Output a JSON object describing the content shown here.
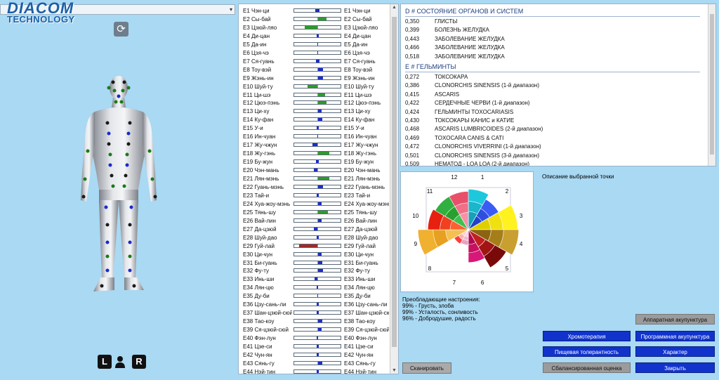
{
  "logo": {
    "line1": "DIACOM",
    "line2": "TECHNOLOGY"
  },
  "select": {
    "value": "",
    "arrow": "▾"
  },
  "icons": {
    "refresh": "⟳"
  },
  "lr": {
    "left": "L",
    "right": "R"
  },
  "meridians": [
    {
      "left": "E1 Чэн-ци",
      "right": "E1 Чэн-ци",
      "dir": "center",
      "size": 6,
      "color": "blue"
    },
    {
      "left": "E2 Сы-бай",
      "right": "E2 Сы-бай",
      "dir": "right",
      "size": 12,
      "color": "green"
    },
    {
      "left": "E3 Цзюй-ляо",
      "right": "E3 Цзюй-ляо",
      "dir": "left",
      "size": 18,
      "color": "green"
    },
    {
      "left": "E4 Ди-цан",
      "right": "E4 Ди-цан",
      "dir": "center",
      "size": 3,
      "color": "blue"
    },
    {
      "left": "E5 Да-ин",
      "right": "E5 Да-ин",
      "dir": "center",
      "size": 1,
      "color": "blue"
    },
    {
      "left": "E6 Цзя-чэ",
      "right": "E6 Цзя-чэ",
      "dir": "center",
      "size": 1,
      "color": "blue"
    },
    {
      "left": "E7 Ся-гуань",
      "right": "E7 Ся-гуань",
      "dir": "center",
      "size": 5,
      "color": "blue"
    },
    {
      "left": "E8 Тоу-вэй",
      "right": "E8 Тоу-вэй",
      "dir": "right",
      "size": 7,
      "color": "blue"
    },
    {
      "left": "E9 Жэнь-ин",
      "right": "E9 Жэнь-ин",
      "dir": "right",
      "size": 7,
      "color": "blue"
    },
    {
      "left": "E10 Шуй-ту",
      "right": "E10 Шуй-ту",
      "dir": "left",
      "size": 14,
      "color": "green"
    },
    {
      "left": "E11 Ци-шэ",
      "right": "E11 Ци-шэ",
      "dir": "right",
      "size": 10,
      "color": "green"
    },
    {
      "left": "E12 Цюэ-пэнь",
      "right": "E12 Цюэ-пэнь",
      "dir": "right",
      "size": 12,
      "color": "green"
    },
    {
      "left": "E13 Ци-ху",
      "right": "E13 Ци-ху",
      "dir": "right",
      "size": 5,
      "color": "blue"
    },
    {
      "left": "E14 Ку-фан",
      "right": "E14 Ку-фан",
      "dir": "right",
      "size": 6,
      "color": "blue"
    },
    {
      "left": "E15 У-и",
      "right": "E15 У-и",
      "dir": "center",
      "size": 3,
      "color": "blue"
    },
    {
      "left": "E16 Ин-чуан",
      "right": "E16 Ин-чуан",
      "dir": "center",
      "size": 1,
      "color": "blue"
    },
    {
      "left": "E17 Жу-чжун",
      "right": "E17 Жу-чжун",
      "dir": "left",
      "size": 7,
      "color": "blue"
    },
    {
      "left": "E18 Жу-гэнь",
      "right": "E18 Жу-гэнь",
      "dir": "right",
      "size": 16,
      "color": "green"
    },
    {
      "left": "E19 Бу-жун",
      "right": "E19 Бу-жун",
      "dir": "center",
      "size": 4,
      "color": "blue"
    },
    {
      "left": "E20 Чэн-мань",
      "right": "E20 Чэн-мань",
      "dir": "left",
      "size": 5,
      "color": "blue"
    },
    {
      "left": "E21 Лян-мэнь",
      "right": "E21 Лян-мэнь",
      "dir": "right",
      "size": 16,
      "color": "green"
    },
    {
      "left": "E22 Гуань-мэнь",
      "right": "E22 Гуань-мэнь",
      "dir": "right",
      "size": 7,
      "color": "blue"
    },
    {
      "left": "E23 Тай-и",
      "right": "E23 Тай-и",
      "dir": "center",
      "size": 3,
      "color": "blue"
    },
    {
      "left": "E24 Хуа-жоу-мэнь",
      "right": "E24 Хуа-жоу-мэнь",
      "dir": "right",
      "size": 5,
      "color": "blue"
    },
    {
      "left": "E25 Тянь-шу",
      "right": "E25 Тянь-шу",
      "dir": "right",
      "size": 14,
      "color": "green"
    },
    {
      "left": "E26 Вай-лин",
      "right": "E26 Вай-лин",
      "dir": "right",
      "size": 5,
      "color": "blue"
    },
    {
      "left": "E27 Да-цзюй",
      "right": "E27 Да-цзюй",
      "dir": "left",
      "size": 5,
      "color": "blue"
    },
    {
      "left": "E28 Шуй-дао",
      "right": "E28 Шуй-дао",
      "dir": "center",
      "size": 3,
      "color": "blue"
    },
    {
      "left": "E29 Гуй-лай",
      "right": "E29 Гуй-лай",
      "dir": "left",
      "size": 26,
      "color": "red"
    },
    {
      "left": "E30 Ци-чун",
      "right": "E30 Ци-чун",
      "dir": "right",
      "size": 5,
      "color": "blue"
    },
    {
      "left": "E31 Би-гуань",
      "right": "E31 Би-гуань",
      "dir": "right",
      "size": 6,
      "color": "blue"
    },
    {
      "left": "E32 Фу-ту",
      "right": "E32 Фу-ту",
      "dir": "right",
      "size": 7,
      "color": "blue"
    },
    {
      "left": "E33 Инь-ши",
      "right": "E33 Инь-ши",
      "dir": "left",
      "size": 4,
      "color": "blue"
    },
    {
      "left": "E34 Лян-цю",
      "right": "E34 Лян-цю",
      "dir": "center",
      "size": 2,
      "color": "blue"
    },
    {
      "left": "E35 Ду-би",
      "right": "E35 Ду-би",
      "dir": "center",
      "size": 1,
      "color": "blue"
    },
    {
      "left": "E36 Цзу-сань-ли",
      "right": "E36 Цзу-сань-ли",
      "dir": "center",
      "size": 3,
      "color": "blue"
    },
    {
      "left": "E37 Шан-цзюй-сюй",
      "right": "E37 Шан-цзюй-сюй",
      "dir": "center",
      "size": 3,
      "color": "blue"
    },
    {
      "left": "E38 Тао-коу",
      "right": "E38 Тао-коу",
      "dir": "right",
      "size": 6,
      "color": "blue"
    },
    {
      "left": "E39 Ся-цзюй-сюй",
      "right": "E39 Ся-цзюй-сюй",
      "dir": "right",
      "size": 5,
      "color": "blue"
    },
    {
      "left": "E40 Фэн-лун",
      "right": "E40 Фэн-лун",
      "dir": "center",
      "size": 2,
      "color": "blue"
    },
    {
      "left": "E41 Цзе-си",
      "right": "E41 Цзе-си",
      "dir": "center",
      "size": 3,
      "color": "blue"
    },
    {
      "left": "E42 Чун-ян",
      "right": "E42 Чун-ян",
      "dir": "center",
      "size": 3,
      "color": "blue"
    },
    {
      "left": "E43 Сянь-гу",
      "right": "E43 Сянь-гу",
      "dir": "right",
      "size": 6,
      "color": "blue"
    },
    {
      "left": "E44 Нэй-тин",
      "right": "E44 Нэй-тин",
      "dir": "center",
      "size": 3,
      "color": "blue"
    }
  ],
  "diagnosis": {
    "sectionD": "D # СОСТОЯНИЕ ОРГАНОВ И СИСТЕМ",
    "rowsD": [
      {
        "v": "0,350",
        "n": "ГЛИСТЫ"
      },
      {
        "v": "0,399",
        "n": "БОЛЕЗНЬ ЖЕЛУДКА"
      },
      {
        "v": "0,443",
        "n": "ЗАБОЛЕВАНИЕ ЖЕЛУДКА"
      },
      {
        "v": "0,466",
        "n": "ЗАБОЛЕВАНИЕ ЖЕЛУДКА"
      },
      {
        "v": "0,518",
        "n": "ЗАБОЛЕВАНИЕ ЖЕЛУДКА"
      }
    ],
    "sectionE": "E # ГЕЛЬМИНТЫ",
    "rowsE": [
      {
        "v": "0,272",
        "n": "ТОКСОКАРА"
      },
      {
        "v": "0,386",
        "n": "CLONORCHIS SINENSIS (1-й диапазон)"
      },
      {
        "v": "0,415",
        "n": "ASCARIS"
      },
      {
        "v": "0,422",
        "n": "СЕРДЕЧНЫЕ ЧЕРВИ (1-й диапазон)"
      },
      {
        "v": "0,424",
        "n": "ГЕЛЬМИНТЫ TOXOCARIASIS"
      },
      {
        "v": "0,430",
        "n": "ТОКСОКАРЫ КАНИС и КАТИЕ"
      },
      {
        "v": "0,468",
        "n": "ASCARIS LUMBRICOIDES (2-й диапазон)"
      },
      {
        "v": "0,469",
        "n": "TOXOCARA CANIS & CATI"
      },
      {
        "v": "0,472",
        "n": "CLONORCHIS VIVERRINI (1-й диапазон)"
      },
      {
        "v": "0,501",
        "n": "CLONORCHIS SINENSIS (3-й диапазон)"
      },
      {
        "v": "0,509",
        "n": "НЕМАТОД - LOA LOA (2-й диапазон)"
      }
    ]
  },
  "rose": {
    "labels": [
      "1",
      "2",
      "3",
      "4",
      "5",
      "6",
      "7",
      "8",
      "9",
      "10",
      "11",
      "12"
    ],
    "sectors": [
      {
        "colors": [
          "#1ec8dc",
          "#19b6cc",
          "#14a2b8"
        ],
        "r": 0.74
      },
      {
        "colors": [
          "#3a5cf5",
          "#2e4ee0",
          "#2240c8"
        ],
        "r": 0.64
      },
      {
        "colors": [
          "#fff21e",
          "#f0e010",
          "#e0cf00"
        ],
        "r": 0.9
      },
      {
        "colors": [
          "#c9a030",
          "#a67e18",
          "#8c6410"
        ],
        "r": 0.92
      },
      {
        "colors": [
          "#7a0a0a",
          "#a01414",
          "#c02020"
        ],
        "r": 0.8
      },
      {
        "colors": [
          "#d81878",
          "#c81060",
          "#b00850"
        ],
        "r": 0.6
      },
      {
        "colors": [
          "#e8a0c0",
          "#f0b8d0",
          "#f8d0e0"
        ],
        "r": 0.28
      },
      {
        "colors": [
          "#ff3c3c",
          "#ffb0b0",
          "#ffd0d0"
        ],
        "r": 0.3
      },
      {
        "colors": [
          "#f0b030",
          "#e8a020",
          "#f4c050"
        ],
        "r": 0.92
      },
      {
        "colors": [
          "#e82010",
          "#f04020",
          "#ff6030"
        ],
        "r": 0.74
      },
      {
        "colors": [
          "#30b040",
          "#28a030",
          "#40c050"
        ],
        "r": 0.7
      },
      {
        "colors": [
          "#e8506a",
          "#f07088",
          "#f890a8"
        ],
        "r": 0.7
      }
    ]
  },
  "description": {
    "label": "Описание выбранной точки"
  },
  "moods": {
    "title": "Преобладающие настроения:",
    "items": [
      "99% - Грусть, злоба",
      "99% - Усталость, сонливость",
      "96% - Добродушие, радость"
    ]
  },
  "buttons": {
    "scan": "Сканировать",
    "apparatus": "Аппаратная акупунктура",
    "chromo": "Хромотерапия",
    "program": "Программная акупунктура",
    "food": "Пищевая толерантность",
    "character": "Характер",
    "balanced": "Сбалансированная оценка",
    "close": "Закрыть"
  },
  "colors": {
    "blue": "#1c2ccc",
    "green": "#2a9c2a",
    "red": "#a02828",
    "accent": "#1133cc"
  }
}
